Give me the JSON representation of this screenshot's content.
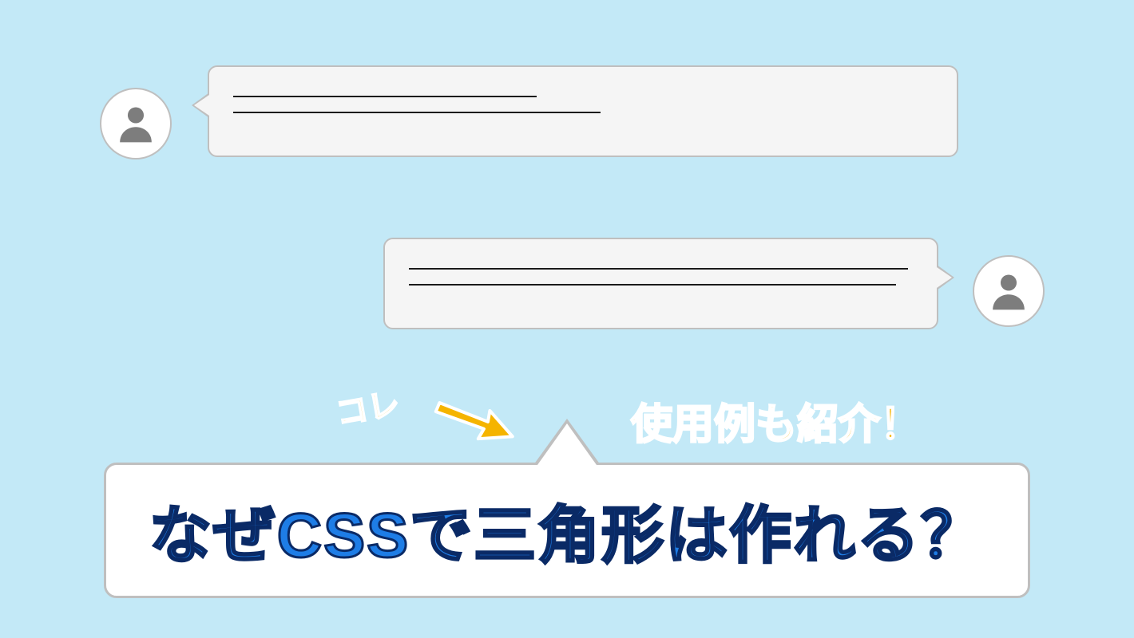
{
  "annotations": {
    "kore": "コレ",
    "example_intro": "使用例も紹介！"
  },
  "title": "なぜCSSで三角形は作れる？",
  "colors": {
    "background": "#c3e9f7",
    "bubble_fill": "#f5f5f5",
    "bubble_border": "#bfbfbf",
    "annotation": "#f5b400",
    "title_fill": "#1e7de6",
    "title_stroke": "#0a2a66",
    "avatar_icon": "#7d7d7d"
  }
}
